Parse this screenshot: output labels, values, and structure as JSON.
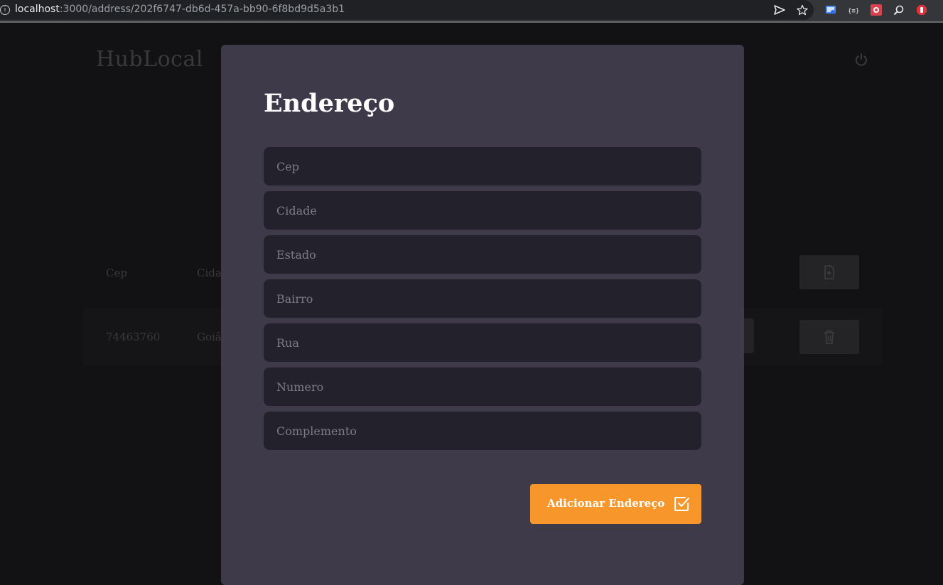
{
  "browser": {
    "url_host": "localhost",
    "url_path": ":3000/address/202f6747-db6d-457a-bb90-6f8bd9d5a3b1",
    "info_glyph": "i"
  },
  "app": {
    "logo": "HubLocal"
  },
  "table": {
    "headers": [
      "Cep",
      "Cida"
    ],
    "row": [
      "74463760",
      "Goiâ"
    ]
  },
  "modal": {
    "title": "Endereço",
    "fields": [
      {
        "placeholder": "Cep"
      },
      {
        "placeholder": "Cidade"
      },
      {
        "placeholder": "Estado"
      },
      {
        "placeholder": "Bairro"
      },
      {
        "placeholder": "Rua"
      },
      {
        "placeholder": "Numero"
      },
      {
        "placeholder": "Complemento"
      }
    ],
    "submit_label": "Adicionar Endereço"
  },
  "colors": {
    "accent": "#f7962b",
    "modal_bg": "#3e3a4a",
    "field_bg": "#23222c",
    "page_bg": "#121214"
  }
}
